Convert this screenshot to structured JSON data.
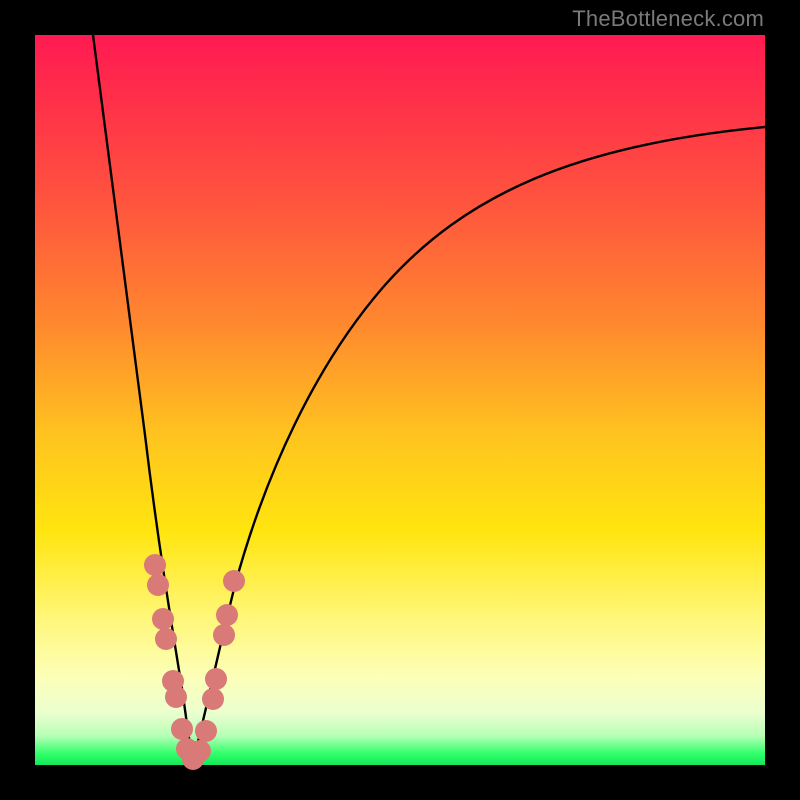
{
  "watermark": "TheBottleneck.com",
  "colors": {
    "frame": "#000000",
    "curve": "#000000",
    "dots": "#d97a78",
    "gradient_top": "#ff1a52",
    "gradient_bottom": "#14e85a"
  },
  "chart_data": {
    "type": "line",
    "title": "",
    "xlabel": "",
    "ylabel": "",
    "xlim": [
      0,
      100
    ],
    "ylim": [
      0,
      100
    ],
    "note": "Axes are unlabeled; values are normalized 0–100. Curve is a V-shaped bottleneck curve with minimum near x≈21. Left branch falls steeply from top-left; right branch rises with decreasing slope toward upper right.",
    "series": [
      {
        "name": "curve_left",
        "x": [
          8,
          10,
          12,
          14,
          16,
          18,
          20,
          21
        ],
        "values": [
          100,
          84,
          68,
          52,
          36,
          22,
          8,
          1
        ]
      },
      {
        "name": "curve_right",
        "x": [
          21,
          23,
          25,
          28,
          32,
          38,
          46,
          56,
          68,
          82,
          100
        ],
        "values": [
          1,
          10,
          20,
          32,
          44,
          56,
          66,
          74,
          80,
          84,
          87
        ]
      }
    ],
    "highlight_points": {
      "name": "cluster_near_minimum",
      "note": "Salmon-colored rounded markers clustered on both branches near the minimum, roughly between y=4 and y=28.",
      "points": [
        {
          "x": 16.0,
          "y": 28
        },
        {
          "x": 16.4,
          "y": 25
        },
        {
          "x": 17.2,
          "y": 20
        },
        {
          "x": 17.6,
          "y": 17
        },
        {
          "x": 18.6,
          "y": 11
        },
        {
          "x": 19.0,
          "y": 9
        },
        {
          "x": 19.8,
          "y": 5
        },
        {
          "x": 20.6,
          "y": 2
        },
        {
          "x": 21.4,
          "y": 1
        },
        {
          "x": 22.4,
          "y": 2
        },
        {
          "x": 23.2,
          "y": 5
        },
        {
          "x": 24.0,
          "y": 10
        },
        {
          "x": 24.4,
          "y": 13
        },
        {
          "x": 25.4,
          "y": 19
        },
        {
          "x": 25.8,
          "y": 22
        },
        {
          "x": 26.8,
          "y": 27
        }
      ]
    }
  }
}
